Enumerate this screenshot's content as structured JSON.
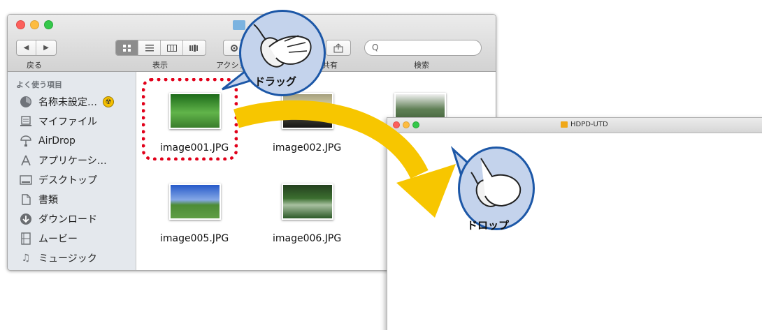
{
  "finder": {
    "back_label": "戻る",
    "back_glyph": "◀",
    "forward_glyph": "▶",
    "view_label": "表示",
    "action_label": "アクション",
    "share_label": "共有",
    "search_label": "検索",
    "search_glyph": "Q",
    "sidebar_heading": "よく使う項目",
    "sidebar": [
      {
        "label": "名称未設定…",
        "icon": "burn-folder-icon"
      },
      {
        "label": "マイファイル",
        "icon": "all-my-files-icon"
      },
      {
        "label": "AirDrop",
        "icon": "airdrop-icon"
      },
      {
        "label": "アプリケーシ…",
        "icon": "applications-icon"
      },
      {
        "label": "デスクトップ",
        "icon": "desktop-icon"
      },
      {
        "label": "書類",
        "icon": "documents-icon"
      },
      {
        "label": "ダウンロード",
        "icon": "downloads-icon"
      },
      {
        "label": "ムービー",
        "icon": "movies-icon"
      },
      {
        "label": "ミュージック",
        "icon": "music-icon"
      }
    ],
    "files": [
      {
        "name": "image001.JPG",
        "selected": true
      },
      {
        "name": "image002.JPG"
      },
      {
        "name": "image005.JPG"
      },
      {
        "name": "image006.JPG"
      }
    ]
  },
  "target_window": {
    "title": "HDPD-UTD"
  },
  "callouts": {
    "drag": "ドラッグ",
    "drop": "ドロップ"
  },
  "colors": {
    "arrow": "#f7c600",
    "selection": "#e1001a",
    "bubble_fill": "#c4d3ec",
    "bubble_border": "#1c57a7"
  }
}
